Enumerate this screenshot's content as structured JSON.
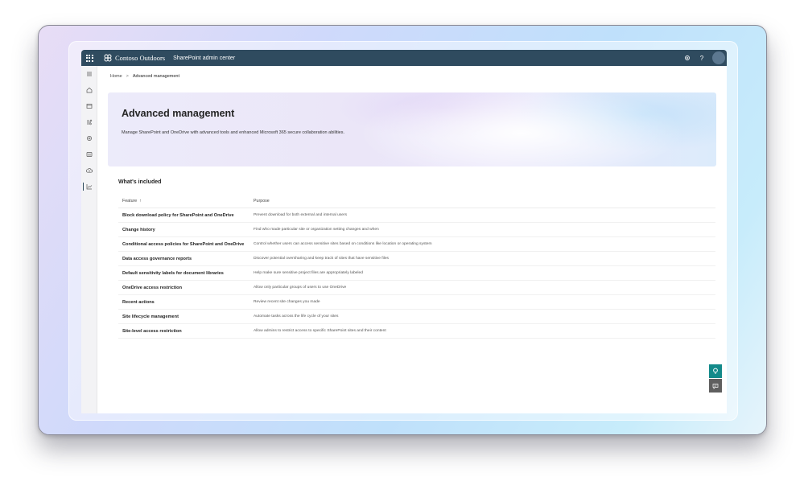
{
  "topbar": {
    "brand_name": "Contoso Outdoors",
    "app_name": "SharePoint admin center",
    "settings_icon": "gear-icon",
    "help_label": "?",
    "bg_color": "#2f4b5f"
  },
  "rail": {
    "items": [
      "menu-icon",
      "home-icon",
      "sites-icon",
      "policies-icon",
      "settings-icon",
      "content-services-icon",
      "migration-icon",
      "reports-icon"
    ],
    "active": "reports-icon"
  },
  "breadcrumb": {
    "home": "Home",
    "separator": ">",
    "current": "Advanced management"
  },
  "hero": {
    "title": "Advanced management",
    "subtitle": "Manage SharePoint and OneDrive with advanced tools and enhanced Microsoft 365 secure collaboration abilities."
  },
  "section": {
    "title": "What's included"
  },
  "table": {
    "headers": {
      "feature": "Feature",
      "sort": "↑",
      "purpose": "Purpose"
    },
    "rows": [
      {
        "feature": "Block download policy for SharePoint and OneDrive",
        "purpose": "Prevent download for both external and internal users"
      },
      {
        "feature": "Change history",
        "purpose": "Find who made particular site or organization setting changes and when"
      },
      {
        "feature": "Conditional access policies for SharePoint and OneDrive",
        "purpose": "Control whether users can access sensitive sites based on conditions like location or operating system"
      },
      {
        "feature": "Data access governance reports",
        "purpose": "Discover potential oversharing and keep track of sites that have sensitive files"
      },
      {
        "feature": "Default sensitivity labels for document libraries",
        "purpose": "Help make sure sensitive project files are appropriately labeled"
      },
      {
        "feature": "OneDrive access restriction",
        "purpose": "Allow only particular groups of users to use OneDrive"
      },
      {
        "feature": "Recent actions",
        "purpose": "Review recent site changes you made"
      },
      {
        "feature": "Site lifecycle management",
        "purpose": "Automate tasks across the life cycle of your sites"
      },
      {
        "feature": "Site-level access restriction",
        "purpose": "Allow admins to restrict access to specific SharePoint sites and their content"
      }
    ]
  },
  "floating": {
    "help_icon": "help-chat-icon",
    "feedback_icon": "feedback-icon",
    "help_color": "#138a8a",
    "feedback_color": "#5f5f5f"
  }
}
